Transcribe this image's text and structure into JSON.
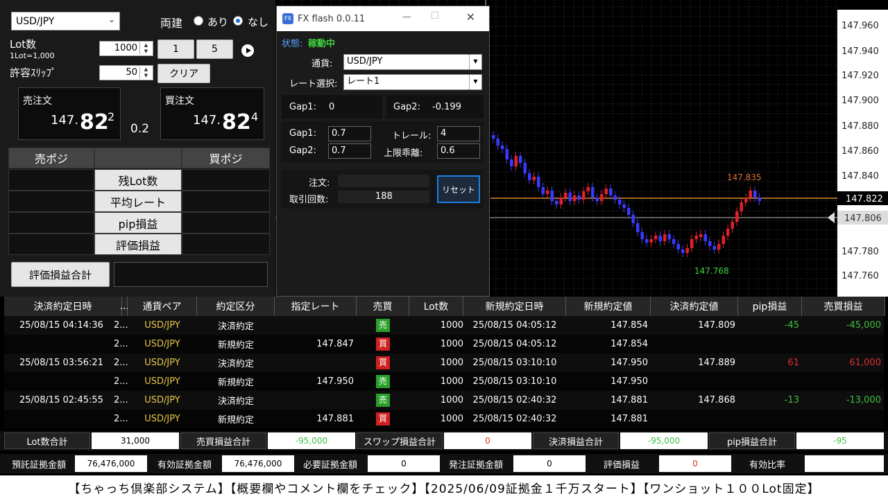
{
  "left_panel": {
    "currency_select": "USD/JPY",
    "ryodate_label": "両建",
    "ari_label": "あり",
    "nashi_label": "なし",
    "lot_label": "Lot数",
    "lot_sub": "1Lot=1,000",
    "lot_value": "1000",
    "btn_1": "1",
    "btn_5": "5",
    "slip_label": "許容ｽﾘｯﾌﾟ",
    "slip_value": "50",
    "clear_label": "クリア",
    "sell_order_label": "売注文",
    "sell_price_main": "147.",
    "sell_price_big": "82",
    "sell_price_sup": "2",
    "spread": "0.2",
    "buy_order_label": "買注文",
    "buy_price_main": "147.",
    "buy_price_big": "82",
    "buy_price_sup": "4",
    "sell_pos_label": "売ポジ",
    "buy_pos_label": "買ポジ",
    "rows": [
      "残Lot数",
      "平均レート",
      "pip損益",
      "評価損益"
    ],
    "total_eval_label": "評価損益合計"
  },
  "dialog": {
    "title": "FX flash 0.0.11",
    "status_label": "状態:",
    "status_value": "稼動中",
    "currency_label": "通貨:",
    "currency_value": "USD/JPY",
    "rate_label": "レート選択:",
    "rate_value": "レート1",
    "gap1_label": "Gap1:",
    "gap1_value": "0",
    "gap2_label": "Gap2:",
    "gap2_value": "-0.199",
    "gap1_input_label": "Gap1:",
    "gap1_input": "0.7",
    "gap2_input_label": "Gap2:",
    "gap2_input": "0.7",
    "trail_label": "トレール:",
    "trail_value": "4",
    "limit_label": "上限乖離:",
    "limit_value": "0.6",
    "order_label": "注文:",
    "trades_label": "取引回数:",
    "trades_value": "188",
    "reset_label": "リセット"
  },
  "chart": {
    "price_ticks": [
      "147.960",
      "147.940",
      "147.920",
      "147.900",
      "147.880",
      "147.860",
      "147.840",
      "147.822",
      "147.806",
      "147.780",
      "147.760"
    ],
    "current_price": "147.822",
    "cursor_price": "147.806",
    "high_label": "147.835",
    "low_label": "147.768",
    "current_line_color": "#e08a2a",
    "up_color": "#e0202a",
    "down_color": "#3a3aff"
  },
  "table": {
    "headers": [
      "決済約定日時",
      "...",
      "通貨ペア",
      "約定区分",
      "指定レート",
      "売買",
      "Lot数",
      "新規約定日時",
      "新規約定値",
      "決済約定値",
      "pip損益",
      "売買損益"
    ],
    "rows": [
      {
        "close_time": "25/08/15 04:14:36",
        "id": "2...",
        "pair": "USD/JPY",
        "kind": "決済約定",
        "rate": "",
        "side": "売",
        "side_color": "#2aa02a",
        "lot": "1000",
        "open_time": "25/08/15 04:05:12",
        "open_price": "147.854",
        "close_price": "147.809",
        "pip": "-45",
        "pl": "-45,000",
        "pl_color": "#3fbf3f"
      },
      {
        "close_time": "",
        "id": "2...",
        "pair": "USD/JPY",
        "kind": "新規約定",
        "rate": "147.847",
        "side": "買",
        "side_color": "#d02020",
        "lot": "1000",
        "open_time": "25/08/15 04:05:12",
        "open_price": "147.854",
        "close_price": "",
        "pip": "",
        "pl": "",
        "pl_color": "#fff"
      },
      {
        "close_time": "25/08/15 03:56:21",
        "id": "2...",
        "pair": "USD/JPY",
        "kind": "決済約定",
        "rate": "",
        "side": "買",
        "side_color": "#d02020",
        "lot": "1000",
        "open_time": "25/08/15 03:10:10",
        "open_price": "147.950",
        "close_price": "147.889",
        "pip": "61",
        "pl": "61,000",
        "pl_color": "#e03030"
      },
      {
        "close_time": "",
        "id": "2...",
        "pair": "USD/JPY",
        "kind": "新規約定",
        "rate": "147.950",
        "side": "売",
        "side_color": "#2aa02a",
        "lot": "1000",
        "open_time": "25/08/15 03:10:10",
        "open_price": "147.950",
        "close_price": "",
        "pip": "",
        "pl": "",
        "pl_color": "#fff"
      },
      {
        "close_time": "25/08/15 02:45:55",
        "id": "2...",
        "pair": "USD/JPY",
        "kind": "決済約定",
        "rate": "",
        "side": "売",
        "side_color": "#2aa02a",
        "lot": "1000",
        "open_time": "25/08/15 02:40:32",
        "open_price": "147.881",
        "close_price": "147.868",
        "pip": "-13",
        "pl": "-13,000",
        "pl_color": "#3fbf3f"
      },
      {
        "close_time": "",
        "id": "2...",
        "pair": "USD/JPY",
        "kind": "新規約定",
        "rate": "147.881",
        "side": "買",
        "side_color": "#d02020",
        "lot": "1000",
        "open_time": "25/08/15 02:40:32",
        "open_price": "147.881",
        "close_price": "",
        "pip": "",
        "pl": "",
        "pl_color": "#fff"
      }
    ]
  },
  "summary1": {
    "lot_total_label": "Lot数合計",
    "lot_total": "31,000",
    "pl_total_label": "売買損益合計",
    "pl_total": "-95,000",
    "swap_label": "スワップ損益合計",
    "swap": "0",
    "settle_label": "決済損益合計",
    "settle": "-95,000",
    "pip_label": "pip損益合計",
    "pip": "-95"
  },
  "summary2": {
    "deposit_label": "預託証拠金額",
    "deposit": "76,476,000",
    "effective_label": "有効証拠金額",
    "effective": "76,476,000",
    "required_label": "必要証拠金額",
    "required": "0",
    "order_margin_label": "発注証拠金額",
    "order_margin": "0",
    "eval_label": "評価損益",
    "eval": "0",
    "ratio_label": "有効比率",
    "ratio": ""
  },
  "footer": "【ちゃっち倶楽部システム】【概要欄やコメント欄をチェック】【2025/06/09証拠金１千万スタート】【ワンショット１００Lot固定】"
}
